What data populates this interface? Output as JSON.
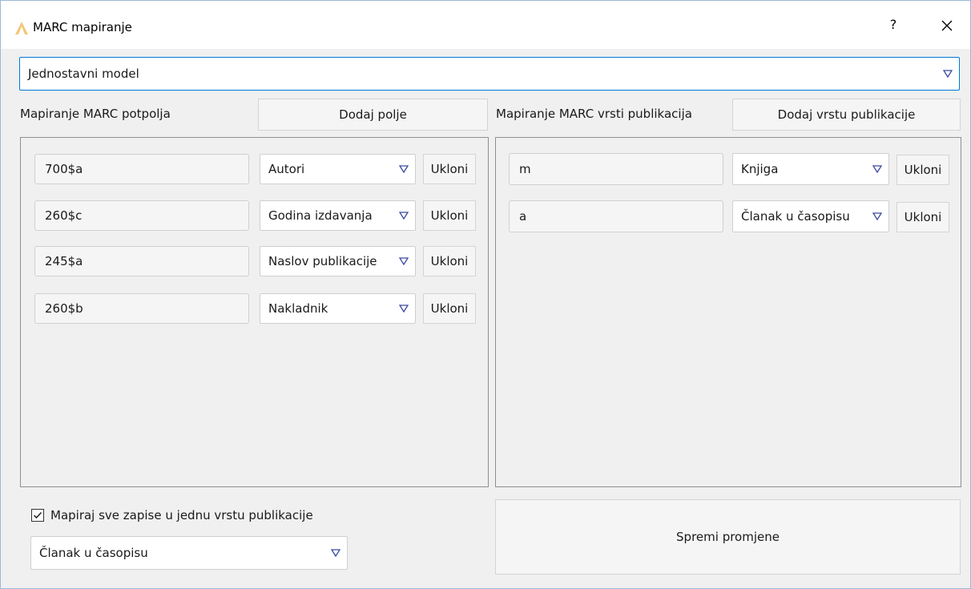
{
  "window": {
    "title": "MARC mapiranje",
    "help_label": "?"
  },
  "model_select": {
    "value": "Jednostavni model"
  },
  "left": {
    "heading": "Mapiranje MARC potpolja",
    "add_button": "Dodaj polje",
    "rows": [
      {
        "field": "700$a",
        "mapping": "Autori",
        "remove": "Ukloni"
      },
      {
        "field": "260$c",
        "mapping": "Godina izdavanja",
        "remove": "Ukloni"
      },
      {
        "field": "245$a",
        "mapping": "Naslov publikacije",
        "remove": "Ukloni"
      },
      {
        "field": "260$b",
        "mapping": "Nakladnik",
        "remove": "Ukloni"
      }
    ]
  },
  "right": {
    "heading": "Mapiranje MARC vrsti publikacija",
    "add_button": "Dodaj vrstu publikacije",
    "rows": [
      {
        "field": "m",
        "mapping": "Knjiga",
        "remove": "Ukloni"
      },
      {
        "field": "a",
        "mapping": "Članak u časopisu",
        "remove": "Ukloni"
      }
    ]
  },
  "bottom": {
    "checkbox_label": "Mapiraj sve zapise u jednu vrstu publikacije",
    "checkbox_checked": true,
    "single_type_select": "Članak u časopisu",
    "save_button": "Spremi promjene"
  },
  "colors": {
    "arrow": "#3a4aa0",
    "focus_border": "#0078d7",
    "icon": "#f3c77a"
  },
  "icons": {
    "app": "app-logo-icon",
    "close": "close-icon",
    "dropdown": "triangle-down-icon",
    "checkbox": "checkbox-checked-icon"
  }
}
